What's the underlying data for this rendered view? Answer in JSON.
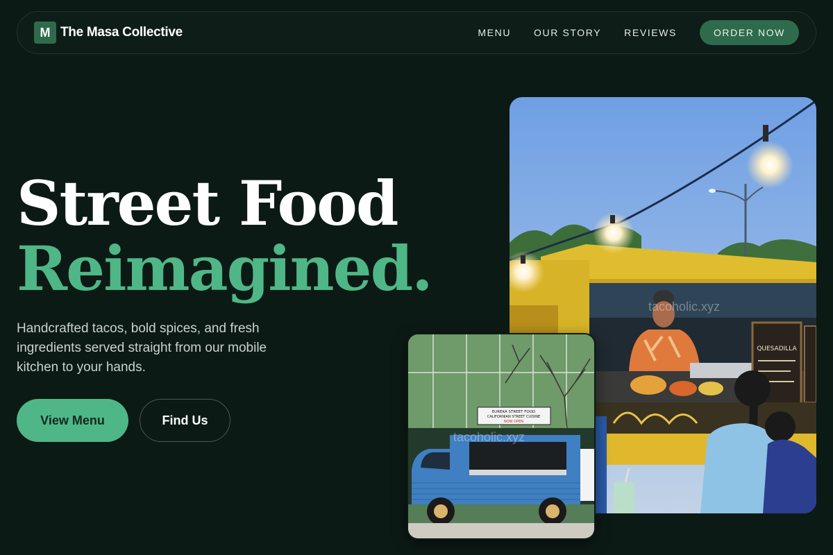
{
  "brand": {
    "mark": "M",
    "name": "The Masa Collective"
  },
  "nav": {
    "links": [
      "MENU",
      "OUR STORY",
      "REVIEWS"
    ],
    "order_label": "ORDER NOW"
  },
  "hero": {
    "title_line1": "Street Food",
    "title_line2": "Reimagined.",
    "description": "Handcrafted tacos, bold spices, and fresh ingredients served straight from our mobile kitchen to your hands.",
    "primary_cta": "View Menu",
    "secondary_cta": "Find Us"
  },
  "images": {
    "main": {
      "watermark": "tacoholic.xyz",
      "chalkboard": "QUESADILLA"
    },
    "truck": {
      "watermark": "tacoholic.xyz",
      "sign_line1": "EUREKA STREET FOOD",
      "sign_line2": "CALIFORNIAN STREET CUISINE",
      "sign_line3": "NOW OPEN"
    }
  },
  "colors": {
    "background": "#0c1a15",
    "accent": "#4fb787",
    "brand_dark_green": "#2e6b4d"
  }
}
